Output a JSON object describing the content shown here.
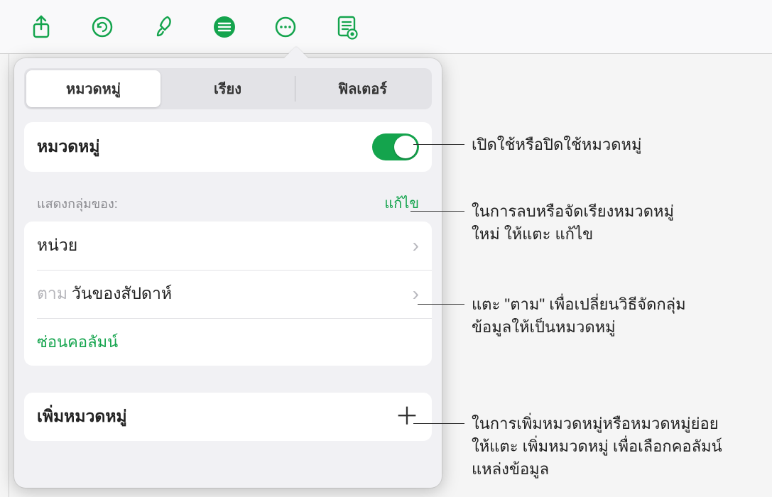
{
  "tabs": {
    "category": "หมวดหมู่",
    "sort": "เรียง",
    "filter": "ฟิลเตอร์"
  },
  "toggle_row": {
    "label": "หมวดหมู่"
  },
  "groups": {
    "header_label": "แสดงกลุ่มของ:",
    "edit_label": "แก้ไข",
    "items": [
      {
        "label": "หน่วย"
      },
      {
        "by_prefix": "ตาม",
        "label": "วันของสัปดาห์"
      }
    ],
    "hide_column": "ซ่อนคอลัมน์"
  },
  "add_category": {
    "label": "เพิ่มหมวดหมู่"
  },
  "callouts": {
    "c1": "เปิดใช้หรือปิดใช้หมวดหมู่",
    "c2_l1": "ในการลบหรือจัดเรียงหมวดหมู่",
    "c2_l2": "ใหม่ ให้แตะ แก้ไข",
    "c3_l1": "แตะ \"ตาม\" เพื่อเปลี่ยนวิธีจัดกลุ่ม",
    "c3_l2": "ข้อมูลให้เป็นหมวดหมู่",
    "c4_l1": "ในการเพิ่มหมวดหมู่หรือหมวดหมู่ย่อย",
    "c4_l2": "ให้แตะ เพิ่มหมวดหมู่ เพื่อเลือกคอลัมน์",
    "c4_l3": "แหล่งข้อมูล"
  },
  "colors": {
    "accent": "#14a44d"
  }
}
